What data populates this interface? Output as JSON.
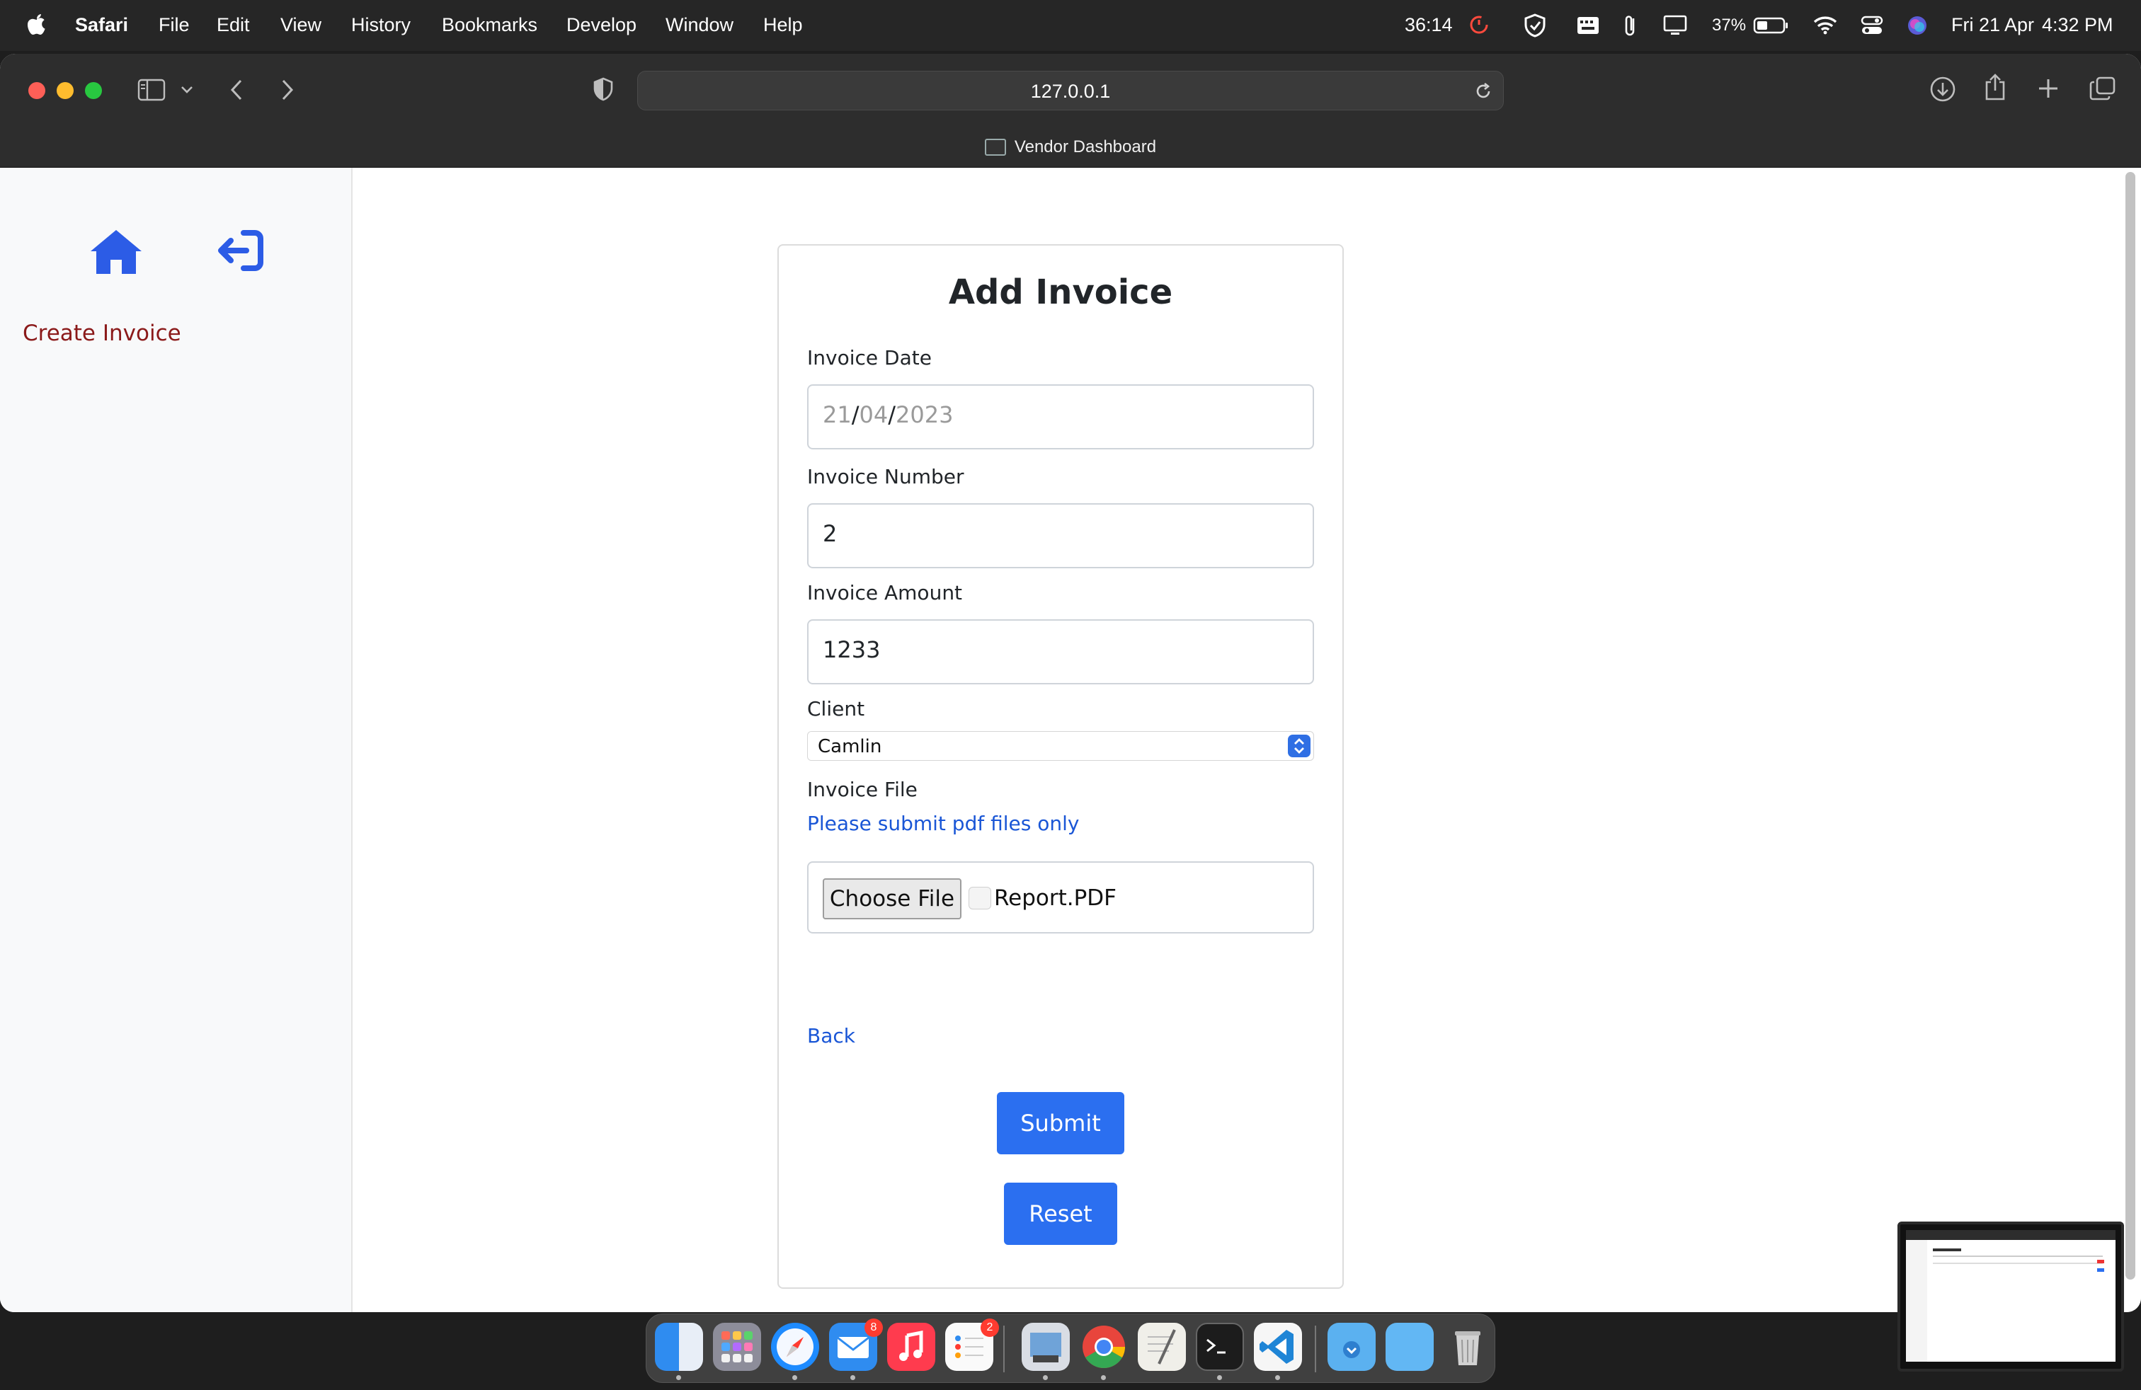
{
  "menubar": {
    "app": "Safari",
    "menus": [
      "File",
      "Edit",
      "View",
      "History",
      "Bookmarks",
      "Develop",
      "Window",
      "Help"
    ],
    "timer": "36:14",
    "battery": "37%",
    "datetime_day": "Fri 21 Apr",
    "datetime_time": "4:32 PM"
  },
  "browser": {
    "url": "127.0.0.1",
    "tab_title": "Vendor Dashboard"
  },
  "sidebar": {
    "create_invoice": "Create Invoice"
  },
  "form": {
    "title": "Add Invoice",
    "invoice_date_label": "Invoice Date",
    "date_day": "21",
    "date_month": "04",
    "date_year": "2023",
    "date_sep": "/",
    "invoice_number_label": "Invoice Number",
    "invoice_number_value": "2",
    "invoice_amount_label": "Invoice Amount",
    "invoice_amount_value": "1233",
    "client_label": "Client",
    "client_value": "Camlin",
    "invoice_file_label": "Invoice File",
    "file_hint": "Please submit pdf files only",
    "choose_file": "Choose File",
    "file_name": "Report.PDF",
    "back": "Back",
    "submit": "Submit",
    "reset": "Reset"
  },
  "dock": {
    "mail_badge": "8",
    "reminders_badge": "2"
  },
  "colors": {
    "primary_button": "#2b6ff0",
    "link": "#1a56d6",
    "sidebar_link": "#8b1a1a",
    "nav_icon": "#2c5ce6"
  }
}
